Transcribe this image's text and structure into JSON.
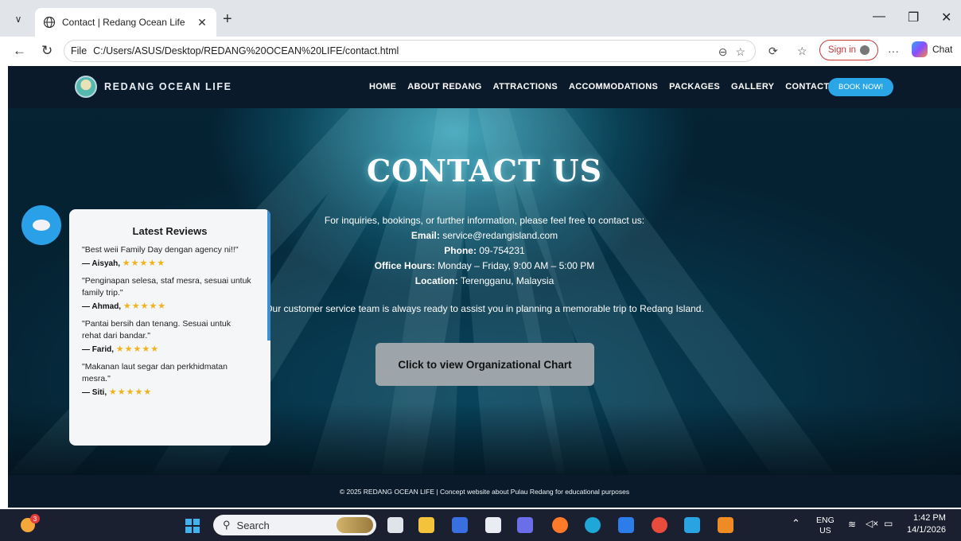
{
  "browser": {
    "tab_title": "Contact | Redang Ocean Life",
    "url_prefix": "File",
    "url": "C:/Users/ASUS/Desktop/REDANG%20OCEAN%20LIFE/contact.html",
    "sign_in": "Sign in",
    "chat": "Chat"
  },
  "site": {
    "brand": "REDANG OCEAN LIFE",
    "nav": [
      "HOME",
      "ABOUT REDANG",
      "ATTRACTIONS",
      "ACCOMMODATIONS",
      "PACKAGES",
      "GALLERY",
      "CONTACT"
    ],
    "book_now": "BOOK NOW!",
    "title": "CONTACT US",
    "intro": "For inquiries, bookings, or further information, please feel free to contact us:",
    "contact": {
      "email_label": "Email:",
      "email": "service@redangisland.com",
      "phone_label": "Phone:",
      "phone": "09-754231",
      "hours_label": "Office Hours:",
      "hours": "Monday – Friday, 9:00 AM – 5:00 PM",
      "location_label": "Location:",
      "location": "Terengganu, Malaysia"
    },
    "team_note": "Our customer service team is always ready to assist you in planning a memorable trip to Redang Island.",
    "org_button": "Click to view Organizational Chart",
    "footer": "© 2025 REDANG OCEAN LIFE | Concept website about Pulau Redang for educational purposes"
  },
  "reviews": {
    "title": "Latest Reviews",
    "stars": "★★★★★",
    "items": [
      {
        "quote": "\"Best weii Family Day dengan agency ni!!\"",
        "author": "— Aisyah,"
      },
      {
        "quote": "\"Penginapan selesa, staf mesra, sesuai untuk family trip.\"",
        "author": "— Ahmad,"
      },
      {
        "quote": "\"Pantai bersih dan tenang. Sesuai untuk rehat dari bandar.\"",
        "author": "— Farid,"
      },
      {
        "quote": "\"Makanan laut segar dan perkhidmatan mesra.\"",
        "author": "— Siti,"
      }
    ]
  },
  "taskbar": {
    "weather_badge": "3",
    "search": "Search",
    "lang_top": "ENG",
    "lang_bottom": "US",
    "time": "1:42 PM",
    "date": "14/1/2026"
  }
}
